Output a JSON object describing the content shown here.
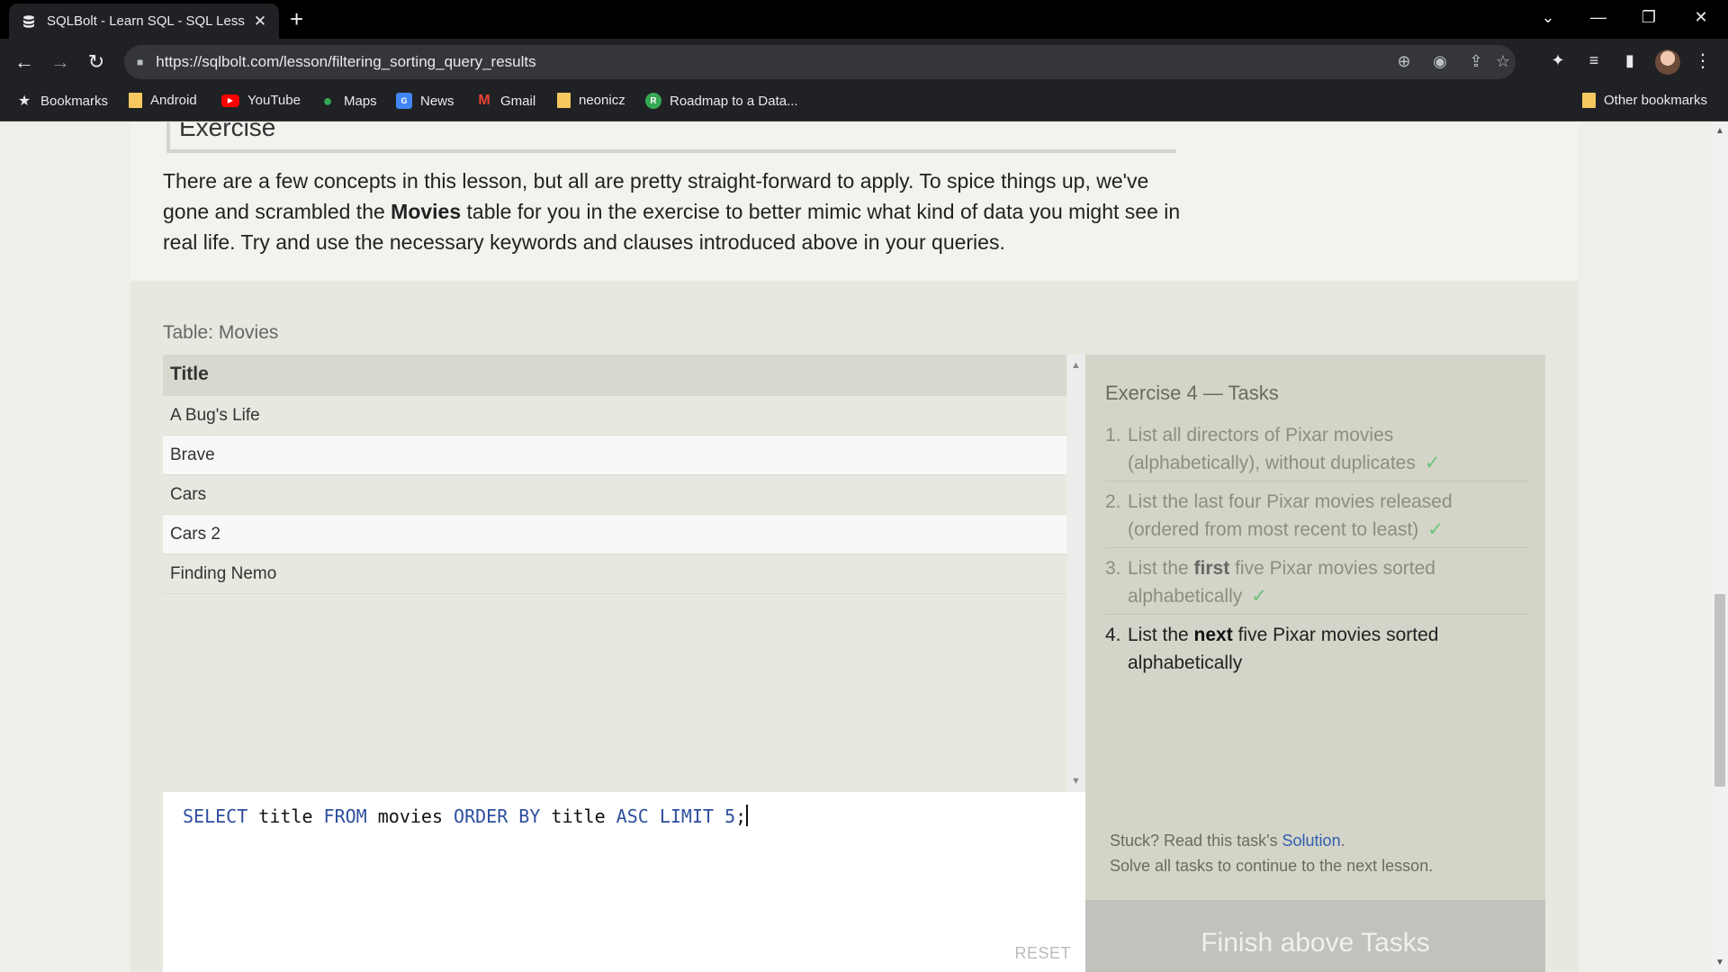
{
  "browser": {
    "tab_title": "SQLBolt - Learn SQL - SQL Lesson",
    "tab_close": "✕",
    "new_tab": "+",
    "url": "https://sqlbolt.com/lesson/filtering_sorting_query_results",
    "bookmarks": [
      {
        "label": "Bookmarks",
        "icon": "star-icon"
      },
      {
        "label": "Android",
        "icon": "folder-icon"
      },
      {
        "label": "YouTube",
        "icon": "youtube-icon"
      },
      {
        "label": "Maps",
        "icon": "maps-icon"
      },
      {
        "label": "News",
        "icon": "news-icon"
      },
      {
        "label": "Gmail",
        "icon": "gmail-icon"
      },
      {
        "label": "neonicz",
        "icon": "folder-icon"
      },
      {
        "label": "Roadmap to a Data...",
        "icon": "roadmap-icon"
      }
    ],
    "other_bookmarks": "Other bookmarks",
    "colors": {
      "chrome": "#202124",
      "tabbar": "#000000",
      "omnibox": "#35363a"
    }
  },
  "lesson": {
    "heading": "Exercise",
    "intro_1": "There are a few concepts in this lesson, but all are pretty straight-forward to apply. To spice things up, we've gone and scrambled the ",
    "intro_bold": "Movies",
    "intro_2": " table for you in the exercise to better mimic what kind of data you might see in real life. Try and use the necessary keywords and clauses introduced above in your queries."
  },
  "table": {
    "label": "Table: Movies",
    "header": "Title",
    "rows": [
      "A Bug's Life",
      "Brave",
      "Cars",
      "Cars 2",
      "Finding Nemo"
    ]
  },
  "editor": {
    "tokens": [
      {
        "text": "SELECT",
        "kw": true
      },
      {
        "text": " title ",
        "kw": false
      },
      {
        "text": "FROM",
        "kw": true
      },
      {
        "text": " movies ",
        "kw": false
      },
      {
        "text": "ORDER BY",
        "kw": true
      },
      {
        "text": " title ",
        "kw": false
      },
      {
        "text": "ASC LIMIT",
        "kw": true
      },
      {
        "text": " ",
        "kw": false
      },
      {
        "text": "5",
        "kw": true
      },
      {
        "text": ";",
        "kw": false
      }
    ],
    "reset_label": "RESET",
    "keyword_color": "#2e4e9e"
  },
  "tasks": {
    "title": "Exercise 4 — Tasks",
    "items": [
      {
        "num": "1.",
        "pre": "List all directors of Pixar movies (alphabetically), without duplicates",
        "bold": "",
        "post": "",
        "done": true
      },
      {
        "num": "2.",
        "pre": "List the last four Pixar movies released (ordered from most recent to least)",
        "bold": "",
        "post": "",
        "done": true
      },
      {
        "num": "3.",
        "pre": "List the ",
        "bold": "first",
        "post": " five Pixar movies sorted alphabetically",
        "done": true
      },
      {
        "num": "4.",
        "pre": "List the ",
        "bold": "next",
        "post": " five Pixar movies sorted alphabetically",
        "done": false
      }
    ],
    "check": "✓",
    "stuck_prefix": "Stuck? Read this task's ",
    "solution_link": "Solution",
    "stuck_suffix": ".",
    "continue_text": "Solve all tasks to continue to the next lesson.",
    "finish_label": "Finish above Tasks"
  }
}
